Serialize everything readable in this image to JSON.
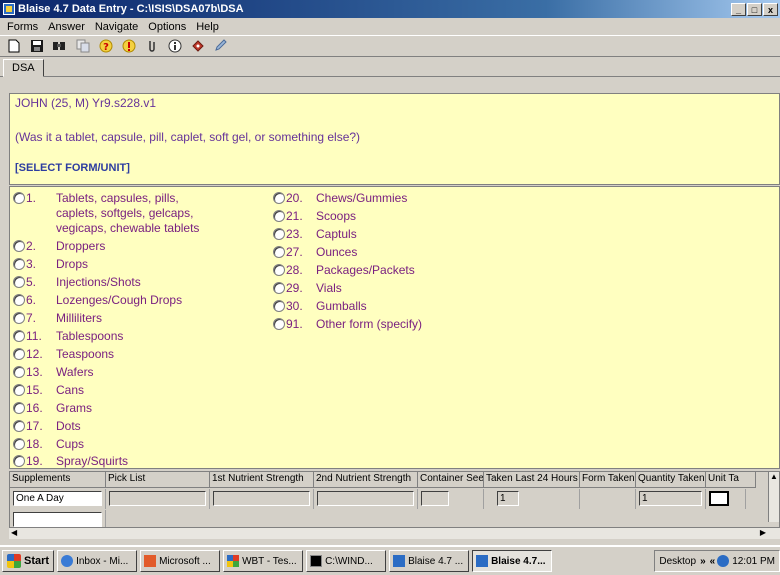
{
  "window": {
    "title": "Blaise 4.7 Data Entry - C:\\ISIS\\DSA07b\\DSA",
    "btn_min": "_",
    "btn_max": "□",
    "btn_close": "x"
  },
  "menu": [
    "Forms",
    "Answer",
    "Navigate",
    "Options",
    "Help"
  ],
  "toolbar": {
    "icons": [
      "new-icon",
      "save-icon",
      "find-icon",
      "copy-icon",
      "help-icon",
      "alert-icon",
      "attach-icon",
      "info-icon",
      "tag-icon",
      "remark-icon"
    ]
  },
  "tabs": {
    "active": "DSA"
  },
  "question": {
    "respondent": "JOHN (25, M)",
    "field": "Yr9.s228.v1",
    "text": "(Was it a tablet, capsule, pill, caplet, soft gel, or something else?)",
    "instruction": "[SELECT FORM/UNIT]"
  },
  "options_col1": [
    {
      "num": "1.",
      "label": "Tablets, capsules, pills, caplets, softgels, gelcaps, vegicaps, chewable tablets"
    },
    {
      "num": "2.",
      "label": "Droppers"
    },
    {
      "num": "3.",
      "label": "Drops"
    },
    {
      "num": "5.",
      "label": "Injections/Shots"
    },
    {
      "num": "6.",
      "label": "Lozenges/Cough Drops"
    },
    {
      "num": "7.",
      "label": "Milliliters"
    },
    {
      "num": "11.",
      "label": "Tablespoons"
    },
    {
      "num": "12.",
      "label": "Teaspoons"
    },
    {
      "num": "13.",
      "label": "Wafers"
    },
    {
      "num": "15.",
      "label": "Cans"
    },
    {
      "num": "16.",
      "label": "Grams"
    },
    {
      "num": "17.",
      "label": "Dots"
    },
    {
      "num": "18.",
      "label": "Cups"
    },
    {
      "num": "19.",
      "label": "Spray/Squirts"
    }
  ],
  "options_col2": [
    {
      "num": "20.",
      "label": "Chews/Gummies"
    },
    {
      "num": "21.",
      "label": "Scoops"
    },
    {
      "num": "23.",
      "label": "Captuls"
    },
    {
      "num": "27.",
      "label": "Ounces"
    },
    {
      "num": "28.",
      "label": "Packages/Packets"
    },
    {
      "num": "29.",
      "label": "Vials"
    },
    {
      "num": "30.",
      "label": "Gumballs"
    },
    {
      "num": "91.",
      "label": "Other form (specify)"
    }
  ],
  "grid": {
    "headers": [
      "Supplements",
      "Pick List",
      "1st Nutrient Strength",
      "2nd Nutrient Strength",
      "Container Seen",
      "Taken Last 24 Hours",
      "Form Taken",
      "Quantity Taken",
      "Unit Ta"
    ],
    "row1": {
      "supplement": "One A Day",
      "taken_last_24": "1",
      "quantity": "1"
    }
  },
  "taskbar": {
    "start": "Start",
    "tasks": [
      "Inbox - Mi...",
      "Microsoft ...",
      "WBT - Tes...",
      "C:\\WIND...",
      "Blaise 4.7 ...",
      "Blaise 4.7..."
    ],
    "tray_desktop": "Desktop",
    "tray_arrows": "»",
    "tray_back": "«",
    "clock": "12:01 PM"
  }
}
